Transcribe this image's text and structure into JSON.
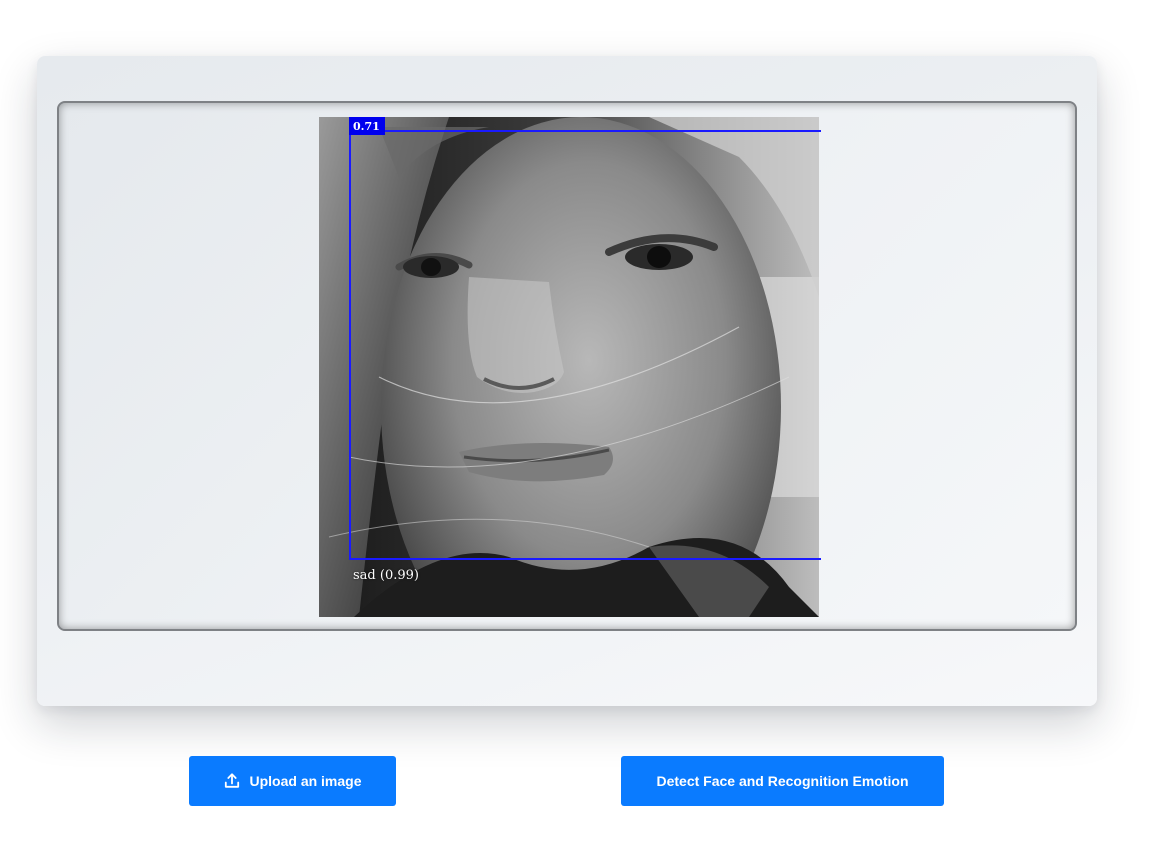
{
  "viewer": {
    "face_score": "0.71",
    "emotion_label": "sad (0.99)",
    "box_color": "#1a1aff"
  },
  "actions": {
    "upload_label": "Upload an image",
    "upload_icon": "upload-icon",
    "detect_label": "Detect Face and Recognition Emotion"
  },
  "theme": {
    "accent": "#0a7bff"
  }
}
